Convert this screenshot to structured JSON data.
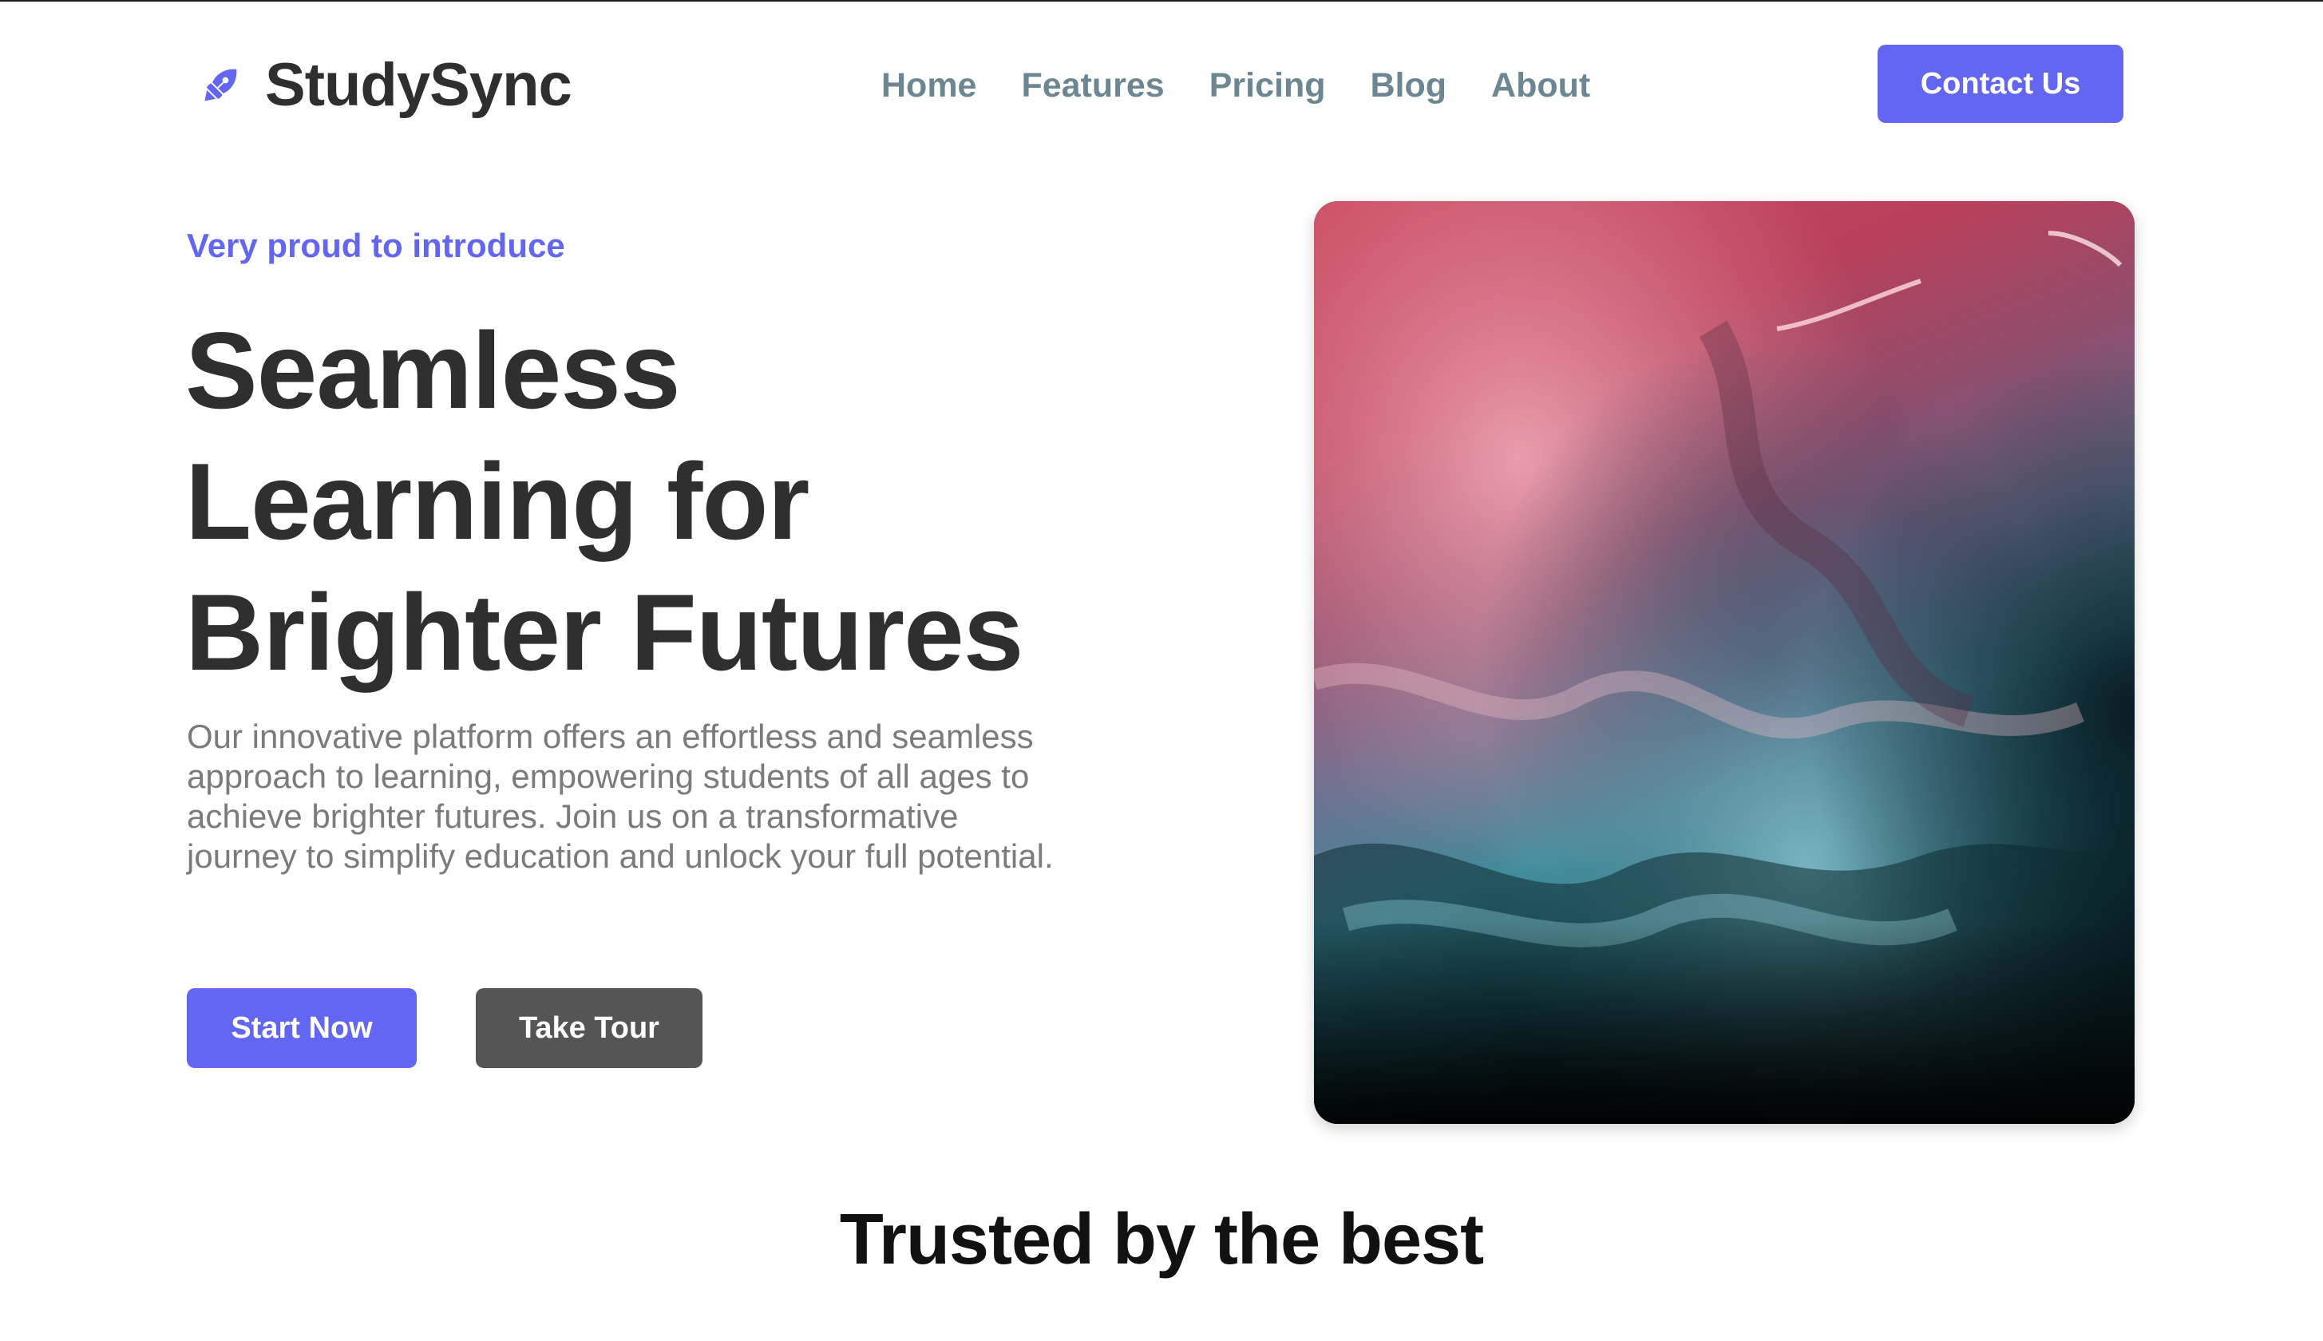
{
  "brand": {
    "name": "StudySync",
    "icon": "fountain-pen-icon"
  },
  "nav": {
    "items": [
      "Home",
      "Features",
      "Pricing",
      "Blog",
      "About"
    ]
  },
  "header": {
    "contact_label": "Contact Us"
  },
  "hero": {
    "eyebrow": "Very proud to introduce",
    "headline_lines": [
      "Seamless",
      "Learning for",
      "Brighter Futures"
    ],
    "description": "Our innovative platform offers an effortless and seamless approach to learning, empowering students of all ages to achieve brighter futures. Join us on a transformative journey to simplify education and unlock your full potential.",
    "primary_cta": "Start Now",
    "secondary_cta": "Take Tour",
    "image": "abstract-fluid-ink-art"
  },
  "trusted": {
    "title": "Trusted by the best"
  },
  "colors": {
    "accent": "#6366f1",
    "nav_text": "#6c8791",
    "heading": "#2f2f2f",
    "body_text": "#7b7b7b",
    "secondary_button": "#555555"
  }
}
